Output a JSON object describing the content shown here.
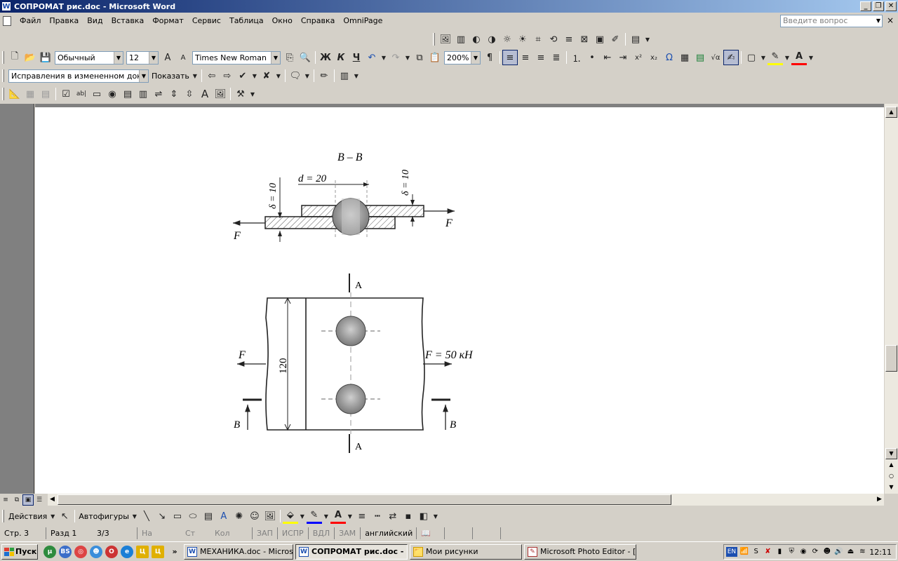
{
  "window": {
    "title": "СОПРОМАТ рис.doc - Microsoft Word",
    "app_icon": "W"
  },
  "menu": {
    "items": [
      "Файл",
      "Правка",
      "Вид",
      "Вставка",
      "Формат",
      "Сервис",
      "Таблица",
      "Окно",
      "Справка",
      "OmniPage"
    ],
    "help_placeholder": "Введите вопрос"
  },
  "formatting": {
    "style": "Обычный",
    "font_size": "12",
    "font_name": "Times New Roman",
    "bold_label": "Ж",
    "italic_label": "К",
    "underline_label": "Ч",
    "zoom": "200%"
  },
  "review": {
    "mode": "Исправления в измененном документ",
    "show_label": "Показать"
  },
  "drawing": {
    "section_title": "B – B",
    "d_label": "d = 20",
    "delta_left": "δ = 10",
    "delta_right": "δ = 10",
    "force_left": "F",
    "force_right": "F",
    "cut_label_top": "A",
    "cut_label_bottom": "A",
    "width_label": "120",
    "force_left_plan": "F",
    "force_right_plan": "F = 50 кН",
    "cut_b_left": "B",
    "cut_b_right": "B"
  },
  "drawbar": {
    "actions_label": "Действия",
    "autoshapes_label": "Автофигуры"
  },
  "status": {
    "page": "Стр. 3",
    "section": "Разд 1",
    "pages": "3/3",
    "at": "На",
    "line": "Ст",
    "col": "Кол",
    "rec": "ЗАП",
    "trk": "ИСПР",
    "ext": "ВДЛ",
    "ovr": "ЗАМ",
    "language": "английский"
  },
  "taskbar": {
    "start_label": "Пуск",
    "tasks": [
      {
        "label": "МЕХАНИКА.doc - Micros...",
        "active": false,
        "icon": "W"
      },
      {
        "label": "СОПРОМАТ рис.doc - ...",
        "active": true,
        "icon": "W"
      },
      {
        "label": "Мои рисунки",
        "active": false,
        "icon": "📁"
      },
      {
        "label": "Microsoft Photo Editor - [...",
        "active": false,
        "icon": "✎"
      }
    ],
    "lang": "EN",
    "clock": "12:11"
  }
}
